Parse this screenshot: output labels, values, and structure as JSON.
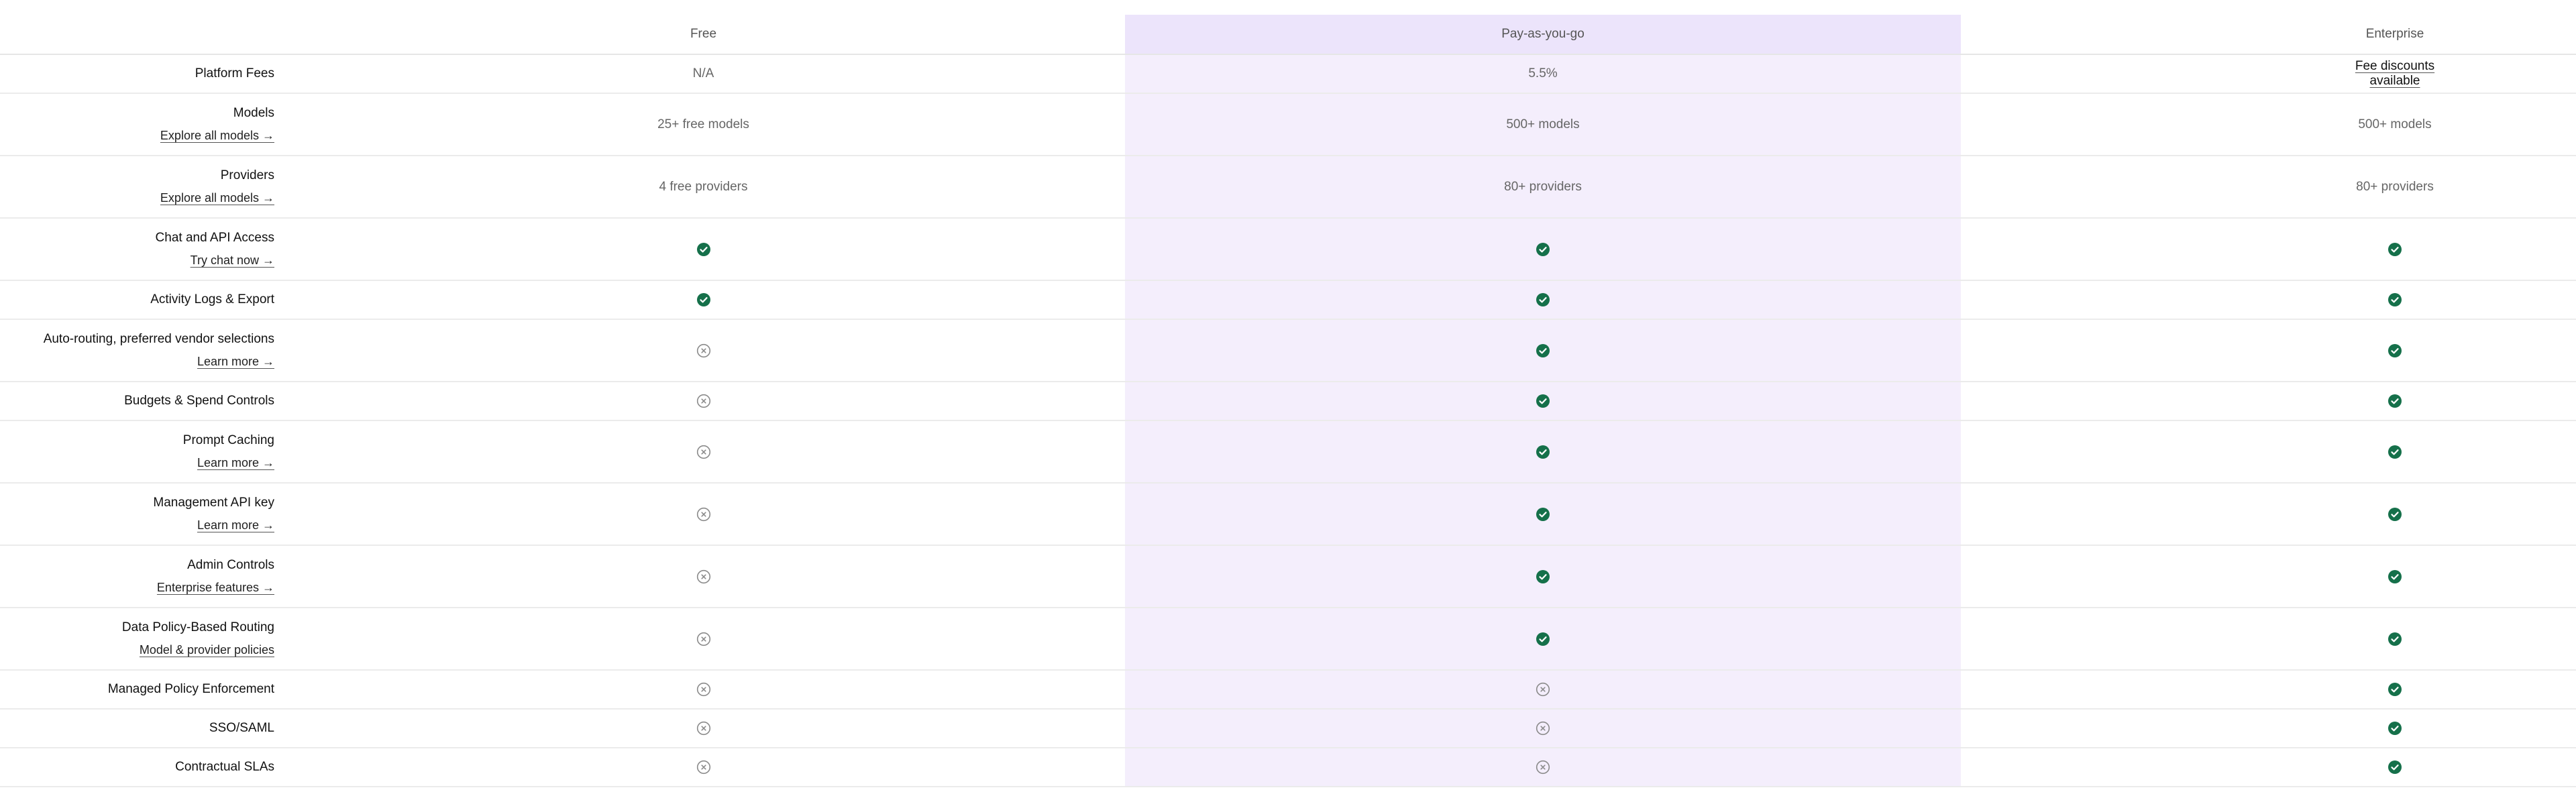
{
  "columns": {
    "free": "Free",
    "payg": "Pay-as-you-go",
    "enterprise": "Enterprise"
  },
  "rows": [
    {
      "label": "Platform Fees",
      "sub": null,
      "free": "N/A",
      "payg": "5.5%",
      "enterprise": "Fee discounts available",
      "enterprise_link": true
    },
    {
      "label": "Models",
      "sub": "Explore all models →",
      "free": "25+ free models",
      "payg": "500+ models",
      "enterprise": "500+ models"
    },
    {
      "label": "Providers",
      "sub": "Explore all models →",
      "free": "4 free providers",
      "payg": "80+ providers",
      "enterprise": "80+ providers"
    },
    {
      "label": "Chat and API Access",
      "sub": "Try chat now →",
      "free": "check",
      "payg": "check",
      "enterprise": "check"
    },
    {
      "label": "Activity Logs & Export",
      "sub": null,
      "free": "check",
      "payg": "check",
      "enterprise": "check"
    },
    {
      "label": "Auto-routing, preferred vendor selections",
      "sub": "Learn more →",
      "free": "x",
      "payg": "check",
      "enterprise": "check"
    },
    {
      "label": "Budgets & Spend Controls",
      "sub": null,
      "free": "x",
      "payg": "check",
      "enterprise": "check"
    },
    {
      "label": "Prompt Caching",
      "sub": "Learn more →",
      "free": "x",
      "payg": "check",
      "enterprise": "check"
    },
    {
      "label": "Management API key",
      "sub": "Learn more →",
      "free": "x",
      "payg": "check",
      "enterprise": "check"
    },
    {
      "label": "Admin Controls",
      "sub": "Enterprise features →",
      "free": "x",
      "payg": "check",
      "enterprise": "check"
    },
    {
      "label": "Data Policy-Based Routing",
      "sub": "Model & provider policies",
      "free": "x",
      "payg": "check",
      "enterprise": "check"
    },
    {
      "label": "Managed Policy Enforcement",
      "sub": null,
      "free": "x",
      "payg": "x",
      "enterprise": "check"
    },
    {
      "label": "SSO/SAML",
      "sub": null,
      "free": "x",
      "payg": "x",
      "enterprise": "check"
    },
    {
      "label": "Contractual SLAs",
      "sub": null,
      "free": "x",
      "payg": "x",
      "enterprise": "check"
    }
  ],
  "icons": {
    "check": "check-circle-icon",
    "x": "x-circle-icon"
  },
  "colors": {
    "check": "#15704a",
    "x_stroke": "#8a8a8a",
    "payg_bg": "#f4eefc",
    "payg_header_bg": "#ece4fb"
  }
}
